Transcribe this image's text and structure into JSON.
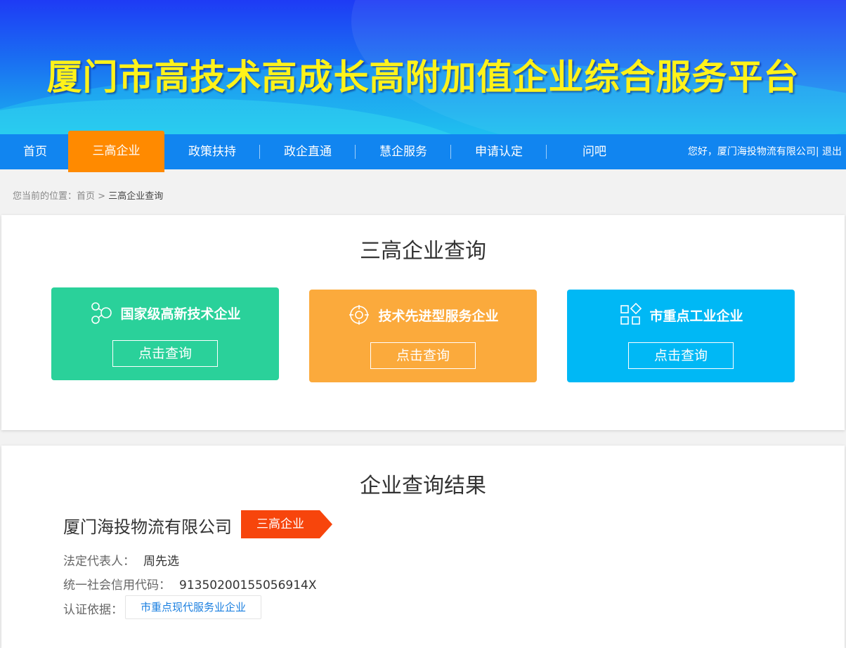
{
  "banner": {
    "title": "厦门市高技术高成长高附加值企业综合服务平台"
  },
  "nav": {
    "items": [
      {
        "label": "首页",
        "active": false
      },
      {
        "label": "三高企业",
        "active": true
      },
      {
        "label": "政策扶持",
        "active": false
      },
      {
        "label": "政企直通",
        "active": false
      },
      {
        "label": "慧企服务",
        "active": false
      },
      {
        "label": "申请认定",
        "active": false
      },
      {
        "label": "问吧",
        "active": false
      }
    ],
    "user": {
      "greeting": "您好，厦门海投物流有限公司",
      "separator": "|",
      "logout": " 退出"
    }
  },
  "breadcrumb": {
    "prefix": "您当前的位置：",
    "home": "首页",
    "arrow": " > ",
    "current": "三高企业查询"
  },
  "query": {
    "title": "三高企业查询",
    "cards": [
      {
        "label": "国家级高新技术企业",
        "button": "点击查询",
        "icon": "molecule-icon",
        "color": "#2ad19a"
      },
      {
        "label": "技术先进型服务企业",
        "button": "点击查询",
        "icon": "target-icon",
        "color": "#fbaa3c"
      },
      {
        "label": "市重点工业企业",
        "button": "点击查询",
        "icon": "grid-icon",
        "color": "#00b8f5"
      }
    ]
  },
  "result": {
    "title": "企业查询结果",
    "company": "厦门海投物流有限公司",
    "tag": "三高企业",
    "legal_rep_label": "法定代表人：",
    "legal_rep": "周先选",
    "credit_code_label": "统一社会信用代码：",
    "credit_code": "91350200155056914X",
    "basis_label": "认证依据：",
    "basis": "市重点现代服务业企业"
  },
  "colors": {
    "nav_bg": "#1185f0",
    "nav_active": "#ff8a00",
    "banner_title": "#fff21a",
    "tag_bg": "#f7450c",
    "link": "#1a7fe0"
  }
}
